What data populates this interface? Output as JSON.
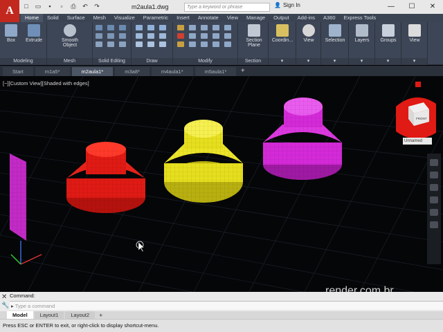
{
  "app": {
    "logo": "A",
    "doc_title": "m2aula1.dwg",
    "search_placeholder": "Type a keyword or phrase",
    "signin_label": "Sign In"
  },
  "ribbon_tabs": [
    "Home",
    "Solid",
    "Surface",
    "Mesh",
    "Visualize",
    "Parametric",
    "Insert",
    "Annotate",
    "View",
    "Manage",
    "Output",
    "Add-ins",
    "A360",
    "Express Tools"
  ],
  "ribbon": {
    "modeling": {
      "box": "Box",
      "extrude": "Extrude",
      "label": "Modeling"
    },
    "mesh": {
      "smooth": "Smooth Object",
      "label": "Mesh"
    },
    "solid_editing": {
      "label": "Solid Editing"
    },
    "draw": {
      "label": "Draw"
    },
    "modify": {
      "label": "Modify"
    },
    "section": {
      "plane": "Section Plane",
      "label": "Section"
    },
    "coordinates": "Coordin...",
    "view_btn": "View",
    "selection": "Selection",
    "layers": "Layers",
    "groups": "Groups",
    "view_btn2": "View"
  },
  "doc_tabs": [
    "Start",
    "m1a5*",
    "m2aula1*",
    "m3a8*",
    "m4aula1*",
    "m5aula1*"
  ],
  "viewport": {
    "label": "[−][Custom View][Shaded with edges]",
    "viewcube_label": "FRONT",
    "ucs_name": "Unnamed"
  },
  "watermark": "render.com.br",
  "command": {
    "history": "Command:",
    "prompt_placeholder": "Type a command"
  },
  "layout_tabs": [
    "Model",
    "Layout1",
    "Layout2"
  ],
  "status_text": "Press ESC or ENTER to exit, or right-click to display shortcut-menu.",
  "colors": {
    "red_solid": "#e01a14",
    "yellow_solid": "#e6df1e",
    "magenta_solid": "#d42ad8",
    "ribbon_bg": "#3d4656",
    "app_red": "#c2281e"
  }
}
